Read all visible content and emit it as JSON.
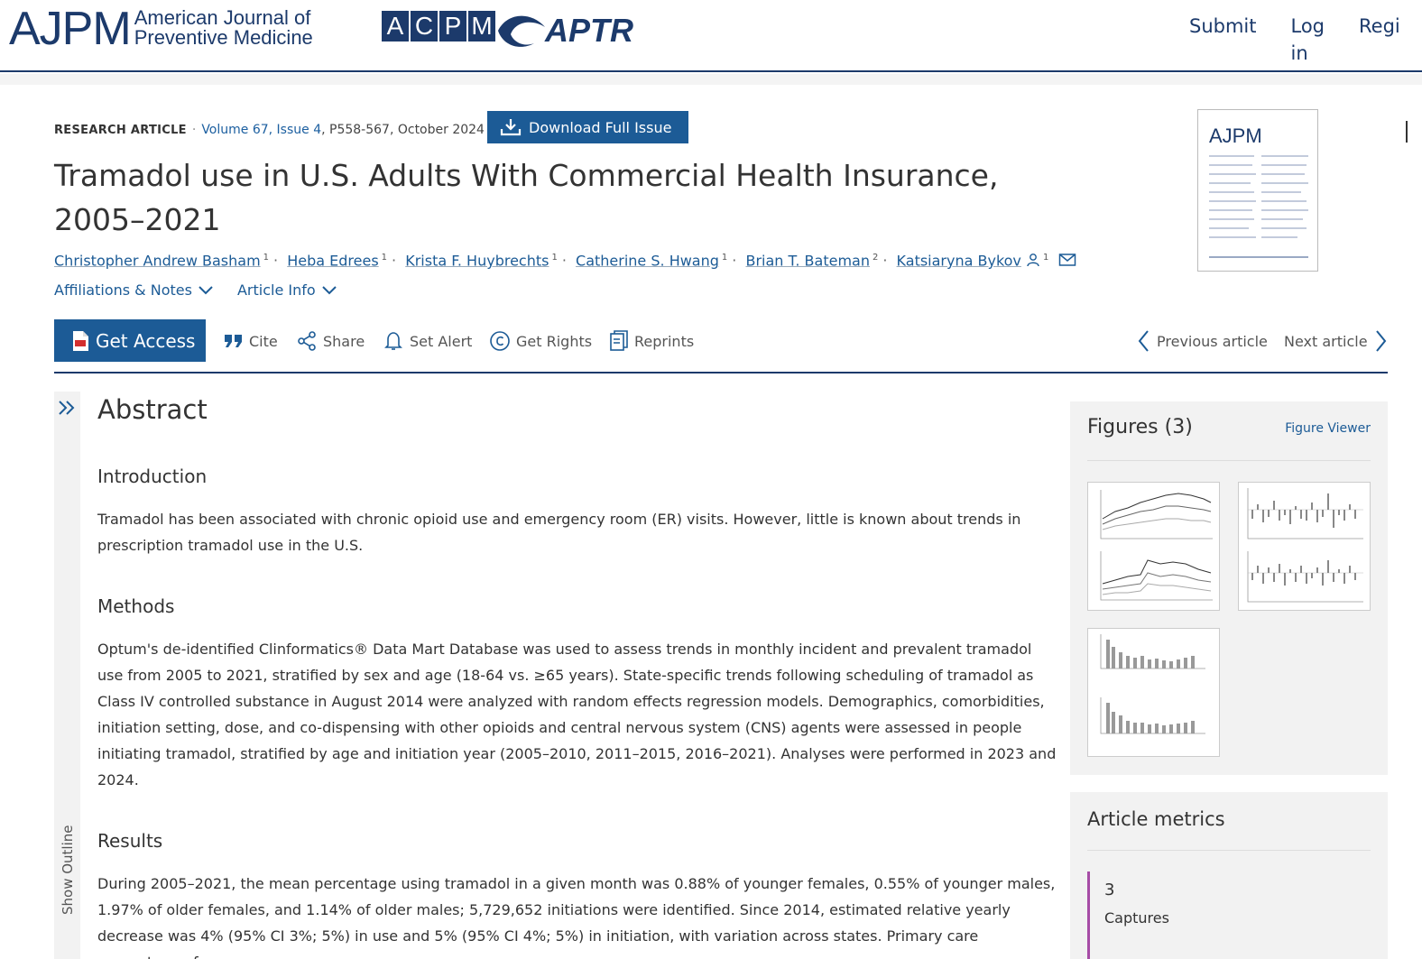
{
  "header": {
    "ajpm_letters": "AJPM",
    "ajpm_sub_line1": "American Journal of",
    "ajpm_sub_line2": "Preventive Medicine",
    "acpm_letters": [
      "A",
      "C",
      "P",
      "M"
    ],
    "aptr_text": "APTR",
    "nav": [
      "Submit",
      "Log in",
      "Regi"
    ]
  },
  "article": {
    "type": "RESEARCH ARTICLE",
    "volume": "Volume 67, Issue 4",
    "pages": ", P558-567, October 2024",
    "download_label": "Download Full Issue",
    "title": "Tramadol use in U.S. Adults With Commercial Health Insurance, 2005–2021",
    "authors": [
      {
        "name": "Christopher Andrew Basham",
        "sup": "1"
      },
      {
        "name": "Heba Edrees",
        "sup": "1"
      },
      {
        "name": "Krista F. Huybrechts",
        "sup": "1"
      },
      {
        "name": "Catherine S. Hwang",
        "sup": "1"
      },
      {
        "name": "Brian T. Bateman",
        "sup": "2"
      },
      {
        "name": "Katsiaryna Bykov",
        "sup": "1"
      }
    ],
    "affiliations_label": "Affiliations & Notes",
    "article_info_label": "Article Info",
    "cover_title": "AJPM"
  },
  "toolbar": {
    "get_access": "Get Access",
    "cite": "Cite",
    "share": "Share",
    "set_alert": "Set Alert",
    "get_rights": "Get Rights",
    "reprints": "Reprints",
    "previous": "Previous article",
    "next": "Next article"
  },
  "outline": {
    "label": "Show Outline"
  },
  "abstract": {
    "heading": "Abstract",
    "sections": [
      {
        "heading": "Introduction",
        "text": "Tramadol has been associated with chronic opioid use and emergency room (ER) visits. However, little is known about trends in prescription tramadol use in the U.S."
      },
      {
        "heading": "Methods",
        "text": "Optum's de-identified Clinformatics® Data Mart Database was used to assess trends in monthly incident and prevalent tramadol use from 2005 to 2021, stratified by sex and age (18-64 vs. ≥65 years). State-specific trends following scheduling of tramadol as Class IV controlled substance in August 2014 were analyzed with random effects regression models. Demographics, comorbidities, initiation setting, dose, and co-dispensing with other opioids and central nervous system (CNS) agents were assessed in people initiating tramadol, stratified by age and initiation year (2005–2010, 2011–2015, 2016–2021). Analyses were performed in 2023 and 2024."
      },
      {
        "heading": "Results",
        "text": "During 2005–2021, the mean percentage using tramadol in a given month was 0.88% of younger females, 0.55% of younger males, 1.97% of older females, and 1.14% of older males; 5,729,652 initiations were identified. Since 2014, estimated relative yearly decrease was 4% (95% CI 3%; 5%) in use and 5% (95% CI 4%; 5%) in initiation, with variation across states. Primary care percentage of"
      }
    ]
  },
  "figures": {
    "heading": "Figures (3)",
    "viewer_label": "Figure Viewer"
  },
  "metrics": {
    "heading": "Article metrics",
    "count": "3",
    "label": "Captures"
  },
  "colors": {
    "navy": "#1c3a6b",
    "link_blue": "#1c5b96",
    "metric_accent": "#a64ca6"
  }
}
